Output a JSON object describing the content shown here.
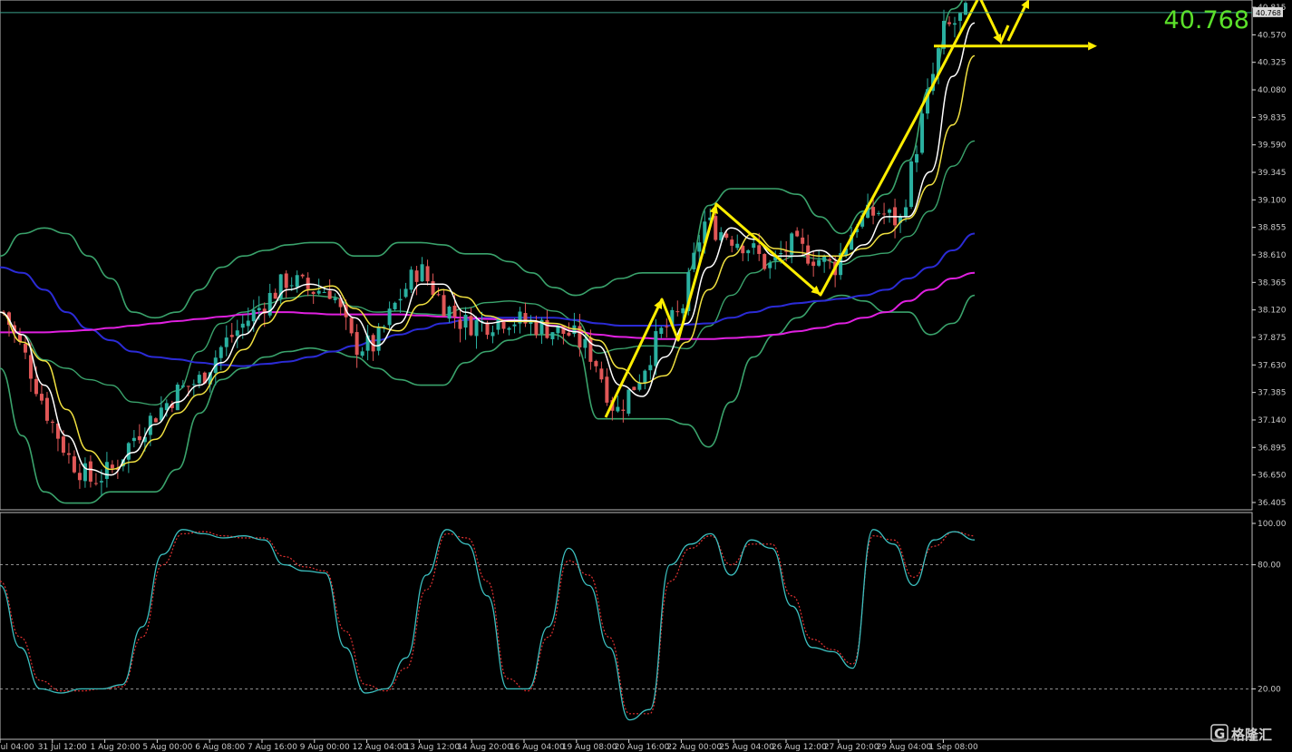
{
  "colors": {
    "background": "#000000",
    "axis": "#d9d9d9",
    "bull_candle": "#2ab0a0",
    "bear_candle": "#e05757",
    "bollinger": "#3aa36c",
    "ma_fast": "#ffffff",
    "ma_mid": "#f0e040",
    "ma_slow": "#2b2bd6",
    "ma_long": "#e020e0",
    "stoch_main": "#3cc0c0",
    "stoch_signal": "#e03030",
    "annotation": "#ffee00",
    "current_price": "#5be02a",
    "price_line": "#3aa08a"
  },
  "chart_data": [
    {
      "type": "candlestick",
      "symbol_current_price": "40.768",
      "current_price_value": 40.768,
      "y_ticks": [
        "40.815",
        "40.570",
        "40.325",
        "40.080",
        "39.835",
        "39.590",
        "39.345",
        "39.100",
        "38.855",
        "38.610",
        "38.365",
        "38.120",
        "37.875",
        "37.630",
        "37.385",
        "37.140",
        "36.895",
        "36.650",
        "36.405"
      ],
      "ylim": [
        36.34,
        40.88
      ],
      "x_ticks": [
        "Jul 04:00",
        "31 Jul 12:00",
        "1 Aug 20:00",
        "5 Aug 00:00",
        "6 Aug 08:00",
        "7 Aug 16:00",
        "9 Aug 00:00",
        "12 Aug 04:00",
        "13 Aug 12:00",
        "14 Aug 20:00",
        "16 Aug 04:00",
        "19 Aug 08:00",
        "20 Aug 16:00",
        "22 Aug 00:00",
        "25 Aug 04:00",
        "26 Aug 12:00",
        "27 Aug 20:00",
        "29 Aug 04:00",
        "1 Sep 08:00"
      ],
      "close_path": [
        38.1,
        37.7,
        37.2,
        36.8,
        36.6,
        36.7,
        37.0,
        37.2,
        37.4,
        37.5,
        37.8,
        38.0,
        38.2,
        38.4,
        38.3,
        38.3,
        37.8,
        37.8,
        38.2,
        38.5,
        38.2,
        38.0,
        38.0,
        38.05,
        38.0,
        37.95,
        37.9,
        37.7,
        37.2,
        37.5,
        37.9,
        38.1,
        38.9,
        38.8,
        38.7,
        38.5,
        38.7,
        38.6,
        38.5,
        38.9,
        39.0,
        38.9,
        39.8,
        40.6,
        40.75
      ],
      "overlays": [
        {
          "name": "bb_upper",
          "values": [
            38.6,
            38.8,
            38.85,
            38.8,
            38.6,
            38.4,
            38.1,
            38.05,
            38.1,
            38.3,
            38.5,
            38.6,
            38.65,
            38.7,
            38.72,
            38.72,
            38.6,
            38.6,
            38.72,
            38.72,
            38.7,
            38.62,
            38.62,
            38.55,
            38.45,
            38.32,
            38.25,
            38.32,
            38.4,
            38.45,
            38.45,
            38.45,
            39.05,
            39.2,
            39.2,
            39.2,
            39.15,
            38.95,
            38.8,
            39.0,
            39.15,
            39.45,
            40.1,
            40.8,
            41.0
          ]
        },
        {
          "name": "bb_lower",
          "values": [
            37.6,
            37.0,
            36.5,
            36.4,
            36.4,
            36.5,
            36.5,
            36.5,
            36.7,
            37.2,
            37.5,
            37.6,
            37.7,
            37.75,
            37.78,
            37.75,
            37.7,
            37.6,
            37.5,
            37.45,
            37.45,
            37.65,
            37.75,
            37.85,
            37.9,
            37.9,
            37.8,
            37.15,
            37.15,
            37.15,
            37.15,
            37.1,
            36.9,
            37.3,
            37.7,
            37.9,
            38.05,
            38.2,
            38.25,
            38.2,
            38.1,
            38.1,
            37.9,
            38.0,
            38.25
          ]
        },
        {
          "name": "ma_slow",
          "values": [
            38.5,
            38.45,
            38.3,
            38.1,
            37.95,
            37.85,
            37.75,
            37.7,
            37.68,
            37.65,
            37.63,
            37.62,
            37.64,
            37.66,
            37.7,
            37.75,
            37.8,
            37.85,
            37.9,
            37.95,
            38.0,
            38.03,
            38.05,
            38.05,
            38.05,
            38.05,
            38.03,
            38.0,
            37.98,
            37.98,
            37.98,
            37.99,
            38.0,
            38.05,
            38.1,
            38.15,
            38.18,
            38.2,
            38.22,
            38.25,
            38.3,
            38.4,
            38.5,
            38.65,
            38.8
          ]
        },
        {
          "name": "ma_long",
          "values": [
            37.92,
            37.92,
            37.92,
            37.93,
            37.94,
            37.96,
            37.98,
            38.0,
            38.02,
            38.04,
            38.06,
            38.08,
            38.1,
            38.1,
            38.09,
            38.08,
            38.08,
            38.08,
            38.08,
            38.07,
            38.06,
            38.05,
            38.04,
            38.03,
            38.02,
            37.98,
            37.93,
            37.9,
            37.88,
            37.87,
            37.86,
            37.86,
            37.86,
            37.87,
            37.88,
            37.9,
            37.93,
            37.96,
            38.0,
            38.05,
            38.1,
            38.2,
            38.3,
            38.4,
            38.45
          ]
        }
      ],
      "annotations": {
        "level_price": 40.47
      }
    },
    {
      "type": "line",
      "indicator": "stochastic",
      "y_ticks": [
        "100.00",
        "80.00",
        "20.00"
      ],
      "ylim": [
        0,
        100
      ],
      "levels": [
        80,
        20
      ],
      "series": [
        {
          "values": [
            70,
            40,
            20,
            18,
            20,
            20,
            22,
            50,
            85,
            97,
            95,
            93,
            94,
            92,
            80,
            77,
            76,
            40,
            18,
            20,
            35,
            75,
            97,
            90,
            65,
            20,
            20,
            50,
            88,
            70,
            40,
            5,
            10,
            80,
            90,
            95,
            75,
            92,
            88,
            60,
            40,
            38,
            30,
            97,
            90,
            70,
            92,
            96,
            92
          ]
        },
        {
          "values": [
            72,
            45,
            24,
            19,
            19,
            20,
            21,
            45,
            80,
            95,
            96,
            94,
            93,
            93,
            84,
            79,
            77,
            48,
            22,
            19,
            30,
            68,
            95,
            93,
            72,
            25,
            19,
            45,
            82,
            75,
            45,
            8,
            8,
            72,
            88,
            94,
            80,
            90,
            90,
            65,
            44,
            39,
            32,
            94,
            92,
            74,
            89,
            96,
            94
          ]
        }
      ]
    }
  ],
  "watermark": {
    "logo": "G",
    "text": "格隆汇"
  }
}
